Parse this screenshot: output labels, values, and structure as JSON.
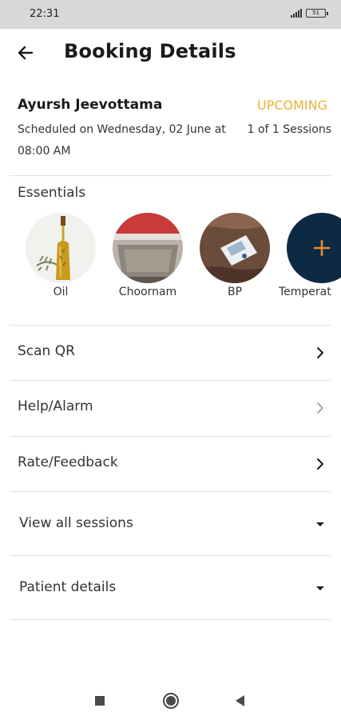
{
  "status_bar": {
    "time": "22:31",
    "battery": "51"
  },
  "header": {
    "title": "Booking Details",
    "back_icon": "arrow-left-icon"
  },
  "booking": {
    "patient_name": "Ayursh Jeevottama",
    "status": "UPCOMING",
    "status_color": "#e9b13a",
    "schedule": "Scheduled on Wednesday, 02 June at 08:00 AM",
    "sessions": "1 of 1 Sessions"
  },
  "essentials": {
    "title": "Essentials",
    "items": [
      {
        "label": "Oil",
        "image": "oil-bottle-photo"
      },
      {
        "label": "Choornam",
        "image": "choornam-photo"
      },
      {
        "label": "BP",
        "image": "bp-monitor-photo"
      },
      {
        "label": "Temperat",
        "image": "plus-icon",
        "accent": "#0d2a45",
        "icon_color": "#e7892f"
      }
    ]
  },
  "menu": {
    "scan_qr": "Scan QR",
    "help_alarm": "Help/Alarm",
    "rate_feedback": "Rate/Feedback",
    "view_all_sessions": "View all sessions",
    "patient_details": "Patient details"
  },
  "nav_bar": {
    "buttons": [
      "square-recents-icon",
      "circle-home-icon",
      "triangle-back-icon"
    ]
  }
}
